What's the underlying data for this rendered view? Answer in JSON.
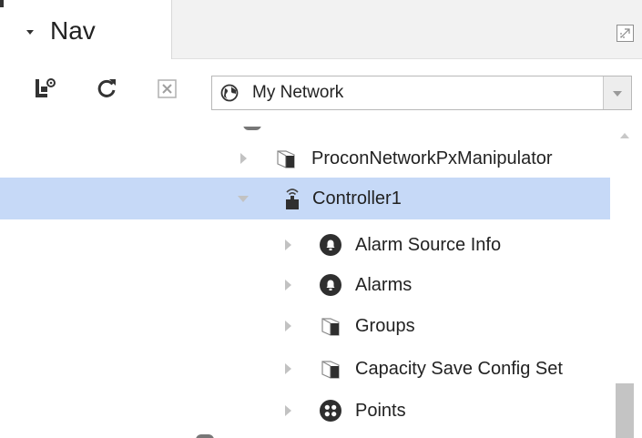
{
  "tab": {
    "label": "Nav"
  },
  "toolbar": {
    "network_selector": {
      "label": "My Network"
    }
  },
  "tree": {
    "items": [
      {
        "label": "ProconNetworkPxManipulator",
        "icon": "cube-icon",
        "expanded": false,
        "selected": false,
        "level": 1
      },
      {
        "label": "Controller1",
        "icon": "controller-icon",
        "expanded": true,
        "selected": true,
        "level": 1
      },
      {
        "label": "Alarm Source Info",
        "icon": "bell-icon",
        "expanded": false,
        "selected": false,
        "level": 2
      },
      {
        "label": "Alarms",
        "icon": "bell-icon",
        "expanded": false,
        "selected": false,
        "level": 2
      },
      {
        "label": "Groups",
        "icon": "cube-icon",
        "expanded": false,
        "selected": false,
        "level": 2
      },
      {
        "label": "Capacity Save Config Set",
        "icon": "cube-icon",
        "expanded": false,
        "selected": false,
        "level": 2
      },
      {
        "label": "Points",
        "icon": "points-icon",
        "expanded": false,
        "selected": false,
        "level": 2
      }
    ]
  },
  "colors": {
    "selection": "#c6d9f7",
    "text": "#222222",
    "toggle": "#c2c2c2",
    "icon_dark": "#333333"
  }
}
